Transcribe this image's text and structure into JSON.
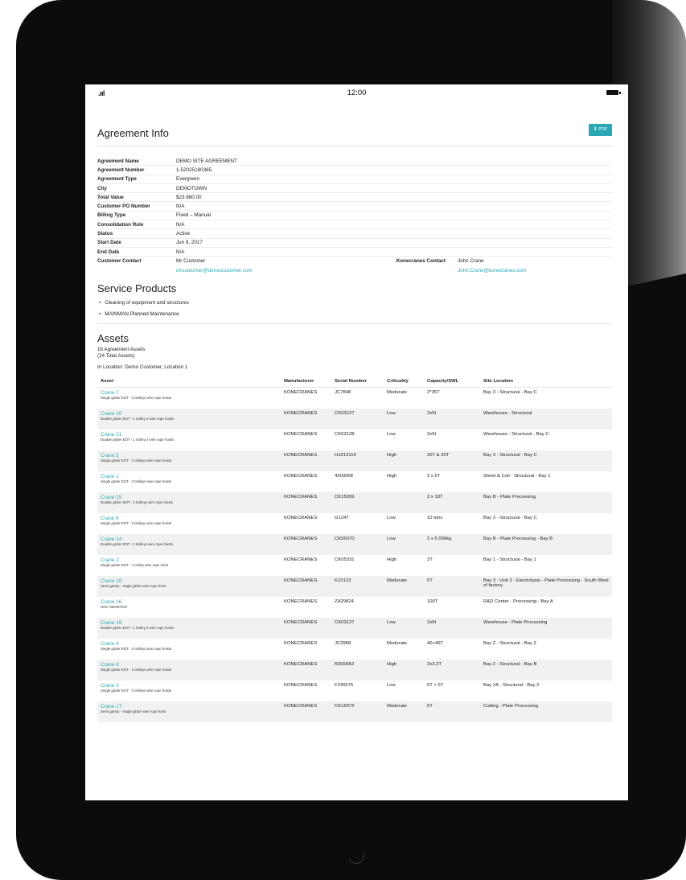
{
  "statusbar": {
    "signal": ".ııl",
    "time": "12:00"
  },
  "agreement": {
    "title": "Agreement Info",
    "pdf_label": "PDF",
    "fields": [
      {
        "label": "Agreement Name",
        "value": "DEMO SITE AGREEMENT"
      },
      {
        "label": "Agreement Number",
        "value": "1-52025180365"
      },
      {
        "label": "Agreement Type",
        "value": "Evergreen"
      },
      {
        "label": "City",
        "value": "DEMOTOWN"
      },
      {
        "label": "Total Value",
        "value": "$23 880,00"
      },
      {
        "label": "Customer PO Number",
        "value": "N/A"
      },
      {
        "label": "Billing Type",
        "value": "Fixed – Manual"
      },
      {
        "label": "Consolidation Rule",
        "value": "N/A"
      },
      {
        "label": "Status",
        "value": "Active"
      },
      {
        "label": "Start Date",
        "value": "Jun 9, 2017"
      },
      {
        "label": "End Date",
        "value": "N/A"
      }
    ],
    "customer_contact_label": "Customer Contact",
    "customer_contact_name": "Mr Customer",
    "customer_contact_email": "mrcustomer@democustomer.com",
    "konecranes_contact_label": "Konecranes Contact",
    "konecranes_contact_name": "John Crane",
    "konecranes_contact_email": "John.Crane@konecranes.com"
  },
  "service": {
    "title": "Service Products",
    "items": [
      "Cleaning of equipment and structures",
      "MAINMAN Planned Maintenance"
    ]
  },
  "assets": {
    "title": "Assets",
    "count_line": "16 Agreement Assets",
    "total_line": "(24 Total Assets)",
    "location_line": "In Location: Demo Customer, Location 1",
    "columns": [
      "Asset",
      "Manufacturer",
      "Serial Number",
      "Criticality",
      "Capacity/SWL",
      "Site Location"
    ],
    "rows": [
      {
        "name": "Crane 7",
        "desc": "Single girder EOT - 2 trolleys wire rope hoists",
        "manufacturer": "KONECRANES",
        "serial": "JC7848",
        "criticality": "Moderate",
        "capacity": "2*35T",
        "location": "Bay 3 - Structural - Bay C"
      },
      {
        "name": "Crane 20",
        "desc": "Double girder EOT - 1 trolley 2 wire rope hoists",
        "manufacturer": "KONECRANES",
        "serial": "CK03127",
        "criticality": "Low",
        "capacity": "2x5t",
        "location": "Warehouse - Structural"
      },
      {
        "name": "Crane 21",
        "desc": "Double girder EOT - 1 trolley 2 wire rope hoists",
        "manufacturer": "KONECRANES",
        "serial": "CK03128",
        "criticality": "Low",
        "capacity": "2x5t",
        "location": "Warehouse - Structural - Bay C"
      },
      {
        "name": "Crane 5",
        "desc": "Single girder EOT - 2 trolleys wire rope hoists",
        "manufacturer": "KONECRANES",
        "serial": "HJZ13119",
        "criticality": "High",
        "capacity": "20T & 20T",
        "location": "Bay 3 - Structural - Bay C"
      },
      {
        "name": "Crane 1",
        "desc": "Single girder EOT - 2 trolleys wire rope hoists",
        "manufacturer": "KONECRANES",
        "serial": "4200058",
        "criticality": "High",
        "capacity": "2 x 5T",
        "location": "Sheet & Coil - Structural - Bay 1"
      },
      {
        "name": "Crane 15",
        "desc": "Double girder EOT - 2 trolleys wire rope hoists",
        "manufacturer": "KONECRANES",
        "serial": "CK15099",
        "criticality": "",
        "capacity": "2 x 10T",
        "location": "Bay B - Plate Processing"
      },
      {
        "name": "Crane 6",
        "desc": "Single girder EOT - 2 trolleys wire rope hoists",
        "manufacturer": "KONECRANES",
        "serial": "G1247",
        "criticality": "Low",
        "capacity": "10 tons",
        "location": "Bay 3 - Structural - Bay C"
      },
      {
        "name": "Crane 14",
        "desc": "Double girder EOT - 2 trolleys wire rope hoists",
        "manufacturer": "KONECRANES",
        "serial": "CK95070",
        "criticality": "Low",
        "capacity": "2 x 5 000kg",
        "location": "Bay B - Plate Processing - Bay B"
      },
      {
        "name": "Crane 2",
        "desc": "Single girder EOT - 1 trolley wire rope hoist",
        "manufacturer": "KONECRANES",
        "serial": "CK05331",
        "criticality": "High",
        "capacity": "2T",
        "location": "Bay 1 - Structural - Bay 1"
      },
      {
        "name": "Crane 18",
        "desc": "Semi gantry - single girder wire rope hoist",
        "manufacturer": "KONECRANES",
        "serial": "K15123",
        "criticality": "Moderate",
        "capacity": "5T",
        "location": "Bay 3 - Unit 3 - Electrolysis - Plate Processing - South West of factory"
      },
      {
        "name": "Crane 16",
        "desc": "HOC SMARTON",
        "manufacturer": "KONECRANES",
        "serial": "ZA29824",
        "criticality": "",
        "capacity": "100T",
        "location": "R&D Center - Processing - Bay A"
      },
      {
        "name": "Crane 19",
        "desc": "Double girder EOT - 1 trolley 2 wire rope hoists",
        "manufacturer": "KONECRANES",
        "serial": "CK03127",
        "criticality": "Low",
        "capacity": "2x5t",
        "location": "Warehouse - Plate Processing"
      },
      {
        "name": "Crane 4",
        "desc": "Single girder EOT - 2 trolleys wire rope hoists",
        "manufacturer": "KONECRANES",
        "serial": "JC3968",
        "criticality": "Moderate",
        "capacity": "40+40T",
        "location": "Bay 2 - Structural - Bay 2"
      },
      {
        "name": "Crane 8",
        "desc": "Single girder EOT - 2 trolleys wire rope hoists",
        "manufacturer": "KONECRANES",
        "serial": "B3558A2",
        "criticality": "High",
        "capacity": "2x3.2T",
        "location": "Bay 2 - Structural - Bay B"
      },
      {
        "name": "Crane 3",
        "desc": "Single girder EOT - 2 trolleys wire rope hoists",
        "manufacturer": "KONECRANES",
        "serial": "F240575",
        "criticality": "Low",
        "capacity": "5T + 5T",
        "location": "Bay 2A - Structural - Bay 2"
      },
      {
        "name": "Crane 17",
        "desc": "Semi gantry - single girder wire rope hoist",
        "manufacturer": "KONECRANES",
        "serial": "CK15072",
        "criticality": "Moderate",
        "capacity": "5T",
        "location": "Cutting - Plate Processing"
      }
    ]
  },
  "colors": {
    "accent": "#2aa8b4",
    "row_alt": "#f1f1f1",
    "device": "#0c0c0c"
  }
}
